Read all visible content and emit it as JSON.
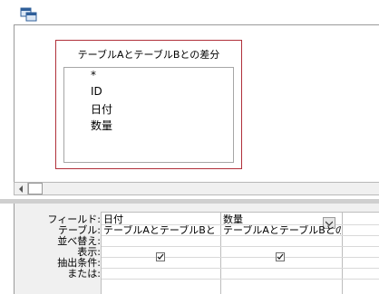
{
  "field_list": {
    "title": "テーブルAとテーブルBとの差分",
    "fields": [
      "*",
      "ID",
      "日付",
      "数量"
    ]
  },
  "grid": {
    "row_labels": [
      "フィールド:",
      "テーブル:",
      "並べ替え:",
      "表示:",
      "抽出条件:",
      "または:"
    ],
    "columns": [
      {
        "field": "日付",
        "table": "テーブルAとテーブルBと",
        "show": true
      },
      {
        "field": "数量",
        "table": "テーブルAとテーブルBとの",
        "show": true
      }
    ]
  },
  "colors": {
    "field_list_border": "#b0303a",
    "pane_background": "#f0f0f0"
  }
}
